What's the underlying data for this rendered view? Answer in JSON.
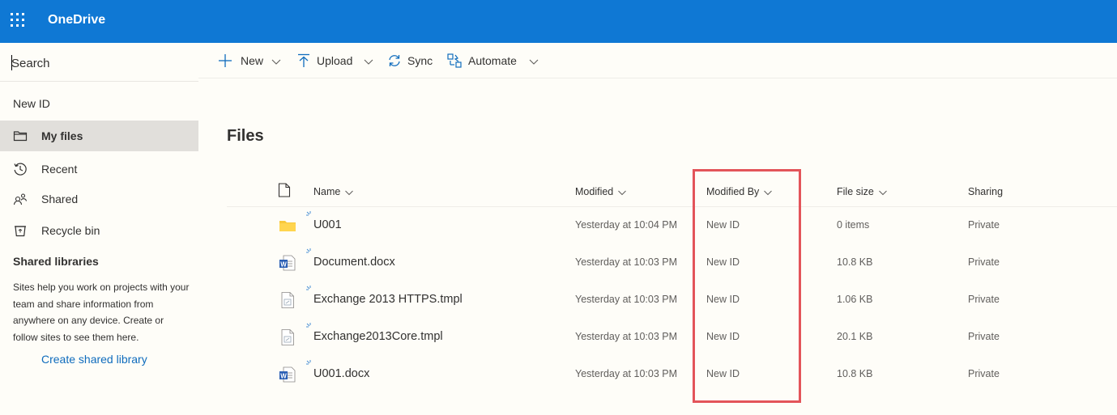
{
  "app": {
    "title": "OneDrive"
  },
  "search": {
    "placeholder": "Search"
  },
  "sidebar": {
    "user_name": "New ID",
    "items": [
      {
        "label": "My files",
        "icon": "folder-icon",
        "active": true
      },
      {
        "label": "Recent",
        "icon": "clock-history-icon",
        "active": false
      },
      {
        "label": "Shared",
        "icon": "people-icon",
        "active": false
      },
      {
        "label": "Recycle bin",
        "icon": "recycle-bin-icon",
        "active": false
      }
    ],
    "shared_libraries_heading": "Shared libraries",
    "shared_libraries_help": "Sites help you work on projects with your team and share information from anywhere on any device. Create or follow sites to see them here.",
    "create_library_link": "Create shared library"
  },
  "toolbar": {
    "new_label": "New",
    "upload_label": "Upload",
    "sync_label": "Sync",
    "automate_label": "Automate"
  },
  "main": {
    "title": "Files",
    "columns": {
      "name": "Name",
      "modified": "Modified",
      "modified_by": "Modified By",
      "file_size": "File size",
      "sharing": "Sharing"
    },
    "rows": [
      {
        "name": "U001",
        "type": "folder-icon",
        "modified": "Yesterday at 10:04 PM",
        "modified_by": "New ID",
        "size": "0 items",
        "sharing": "Private"
      },
      {
        "name": "Document.docx",
        "type": "word-doc-icon",
        "modified": "Yesterday at 10:03 PM",
        "modified_by": "New ID",
        "size": "10.8 KB",
        "sharing": "Private"
      },
      {
        "name": "Exchange 2013 HTTPS.tmpl",
        "type": "generic-file-icon",
        "modified": "Yesterday at 10:03 PM",
        "modified_by": "New ID",
        "size": "1.06 KB",
        "sharing": "Private"
      },
      {
        "name": "Exchange2013Core.tmpl",
        "type": "generic-file-icon",
        "modified": "Yesterday at 10:03 PM",
        "modified_by": "New ID",
        "size": "20.1 KB",
        "sharing": "Private"
      },
      {
        "name": "U001.docx",
        "type": "word-doc-icon",
        "modified": "Yesterday at 10:03 PM",
        "modified_by": "New ID",
        "size": "10.8 KB",
        "sharing": "Private"
      }
    ]
  },
  "colors": {
    "brand": "#0f78d4",
    "link": "#0f6cbd",
    "highlight": "#e3545a",
    "background": "#fefdf8"
  }
}
